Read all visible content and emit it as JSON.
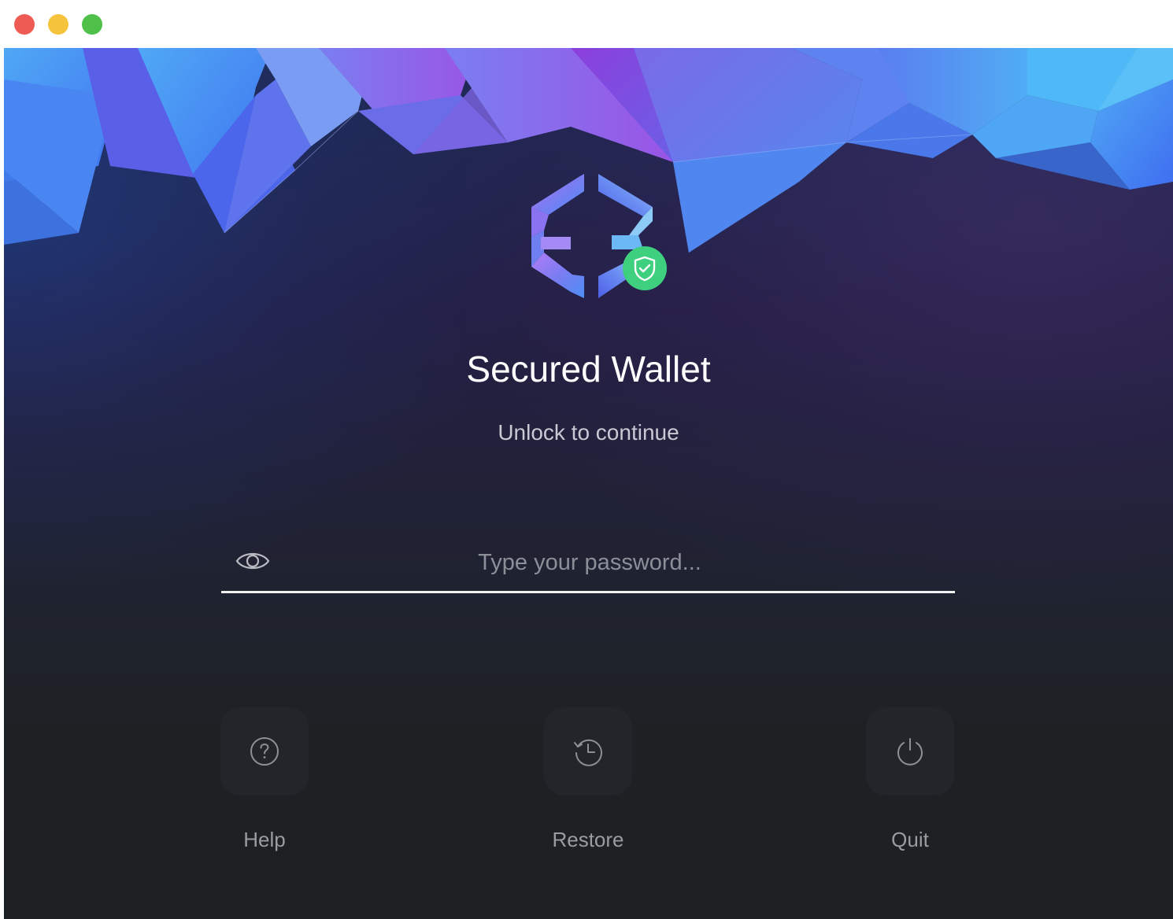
{
  "window": {
    "controls": [
      "close",
      "minimize",
      "maximize"
    ]
  },
  "header": {
    "logo_icon": "exodus-logo-icon",
    "badge_icon": "shield-check-icon"
  },
  "lock_screen": {
    "title": "Secured Wallet",
    "subtitle": "Unlock to continue"
  },
  "password": {
    "placeholder": "Type your password...",
    "value": "",
    "toggle_icon": "eye-icon"
  },
  "actions": [
    {
      "label": "Help",
      "icon": "question-circle-icon"
    },
    {
      "label": "Restore",
      "icon": "history-clock-icon"
    },
    {
      "label": "Quit",
      "icon": "power-icon"
    }
  ],
  "colors": {
    "badge_green": "#3ecf7f",
    "accent_blue": "#4a7dff",
    "accent_purple": "#8b4fe0",
    "button_bg": "#22262b",
    "close": "#ee5b55",
    "minimize": "#f6c33c",
    "maximize": "#4fc14a"
  }
}
